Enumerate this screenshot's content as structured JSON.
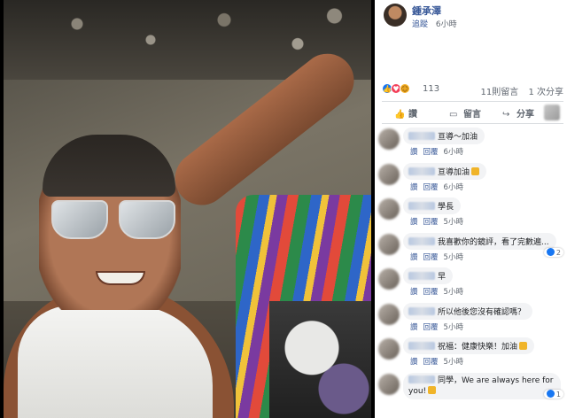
{
  "post": {
    "author": "鍾承澤",
    "follow": "追蹤",
    "time": "6小時"
  },
  "reactions": {
    "icons": [
      "like-icon",
      "love-icon",
      "haha-icon"
    ],
    "count": "113",
    "comments_count": "11則留言",
    "shares_count": "1 次分享"
  },
  "actions": {
    "like": "讚",
    "comment": "留言",
    "share": "分享"
  },
  "comments": [
    {
      "text": "亘導～加油",
      "time": "6小時",
      "like": "讚",
      "reply": "回覆",
      "emoji": false
    },
    {
      "text": "亘導加油",
      "time": "6小時",
      "like": "讚",
      "reply": "回覆",
      "emoji": true
    },
    {
      "text": "學長",
      "time": "5小時",
      "like": "讚",
      "reply": "回覆",
      "emoji": false
    },
    {
      "text": "我喜歡你的鏡評，看了完數遍...",
      "time": "5小時",
      "like": "讚",
      "reply": "回覆",
      "emoji": false,
      "likes": "2"
    },
    {
      "text": "早",
      "time": "5小時",
      "like": "讚",
      "reply": "回覆",
      "emoji": false
    },
    {
      "text": "所以他後您沒有確認嗎？",
      "time": "5小時",
      "like": "讚",
      "reply": "回覆",
      "emoji": false
    },
    {
      "text": "祝福：健康快樂！加油",
      "time": "5小時",
      "like": "讚",
      "reply": "回覆",
      "emoji": true
    },
    {
      "text": "同學，We are always here for you!",
      "time": "",
      "like": "",
      "reply": "",
      "emoji": true,
      "likes": "1"
    }
  ],
  "colors": {
    "link": "#385898",
    "meta": "#606770",
    "bubble": "#f2f3f5",
    "like_blue": "#1877f2"
  }
}
